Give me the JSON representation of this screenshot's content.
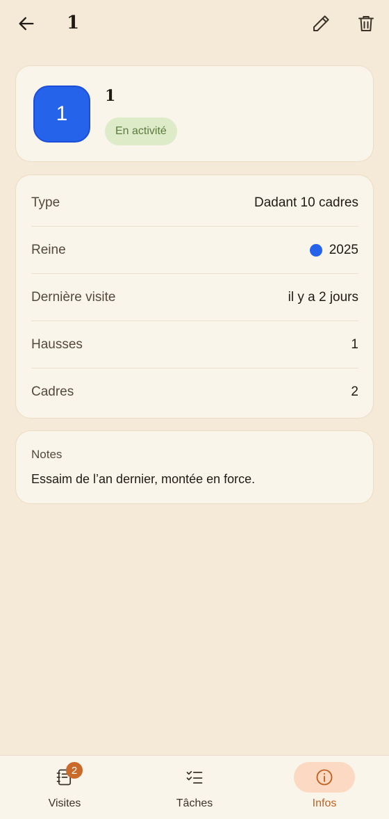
{
  "header": {
    "title": "1",
    "back_icon": "arrow-left-icon",
    "edit_icon": "pencil-icon",
    "delete_icon": "trash-icon"
  },
  "hive": {
    "badge_number": "1",
    "badge_color": "#2563eb",
    "name": "1",
    "status": "En activité",
    "status_color": "#5b7a3e"
  },
  "details": [
    {
      "label": "Type",
      "value": "Dadant 10 cadres"
    },
    {
      "label": "Reine",
      "value": "2025",
      "dot_color": "#2563eb"
    },
    {
      "label": "Dernière visite",
      "value": "il y a 2 jours"
    },
    {
      "label": "Hausses",
      "value": "1"
    },
    {
      "label": "Cadres",
      "value": "2"
    }
  ],
  "notes": {
    "label": "Notes",
    "text": "Essaim de l’an dernier, montée en force."
  },
  "bottom_nav": {
    "items": [
      {
        "label": "Visites",
        "icon": "notebook-icon",
        "count": "2",
        "active": false
      },
      {
        "label": "Tâches",
        "icon": "checklist-icon",
        "active": false
      },
      {
        "label": "Infos",
        "icon": "info-icon",
        "active": true
      }
    ],
    "active_color": "#c2611f"
  }
}
